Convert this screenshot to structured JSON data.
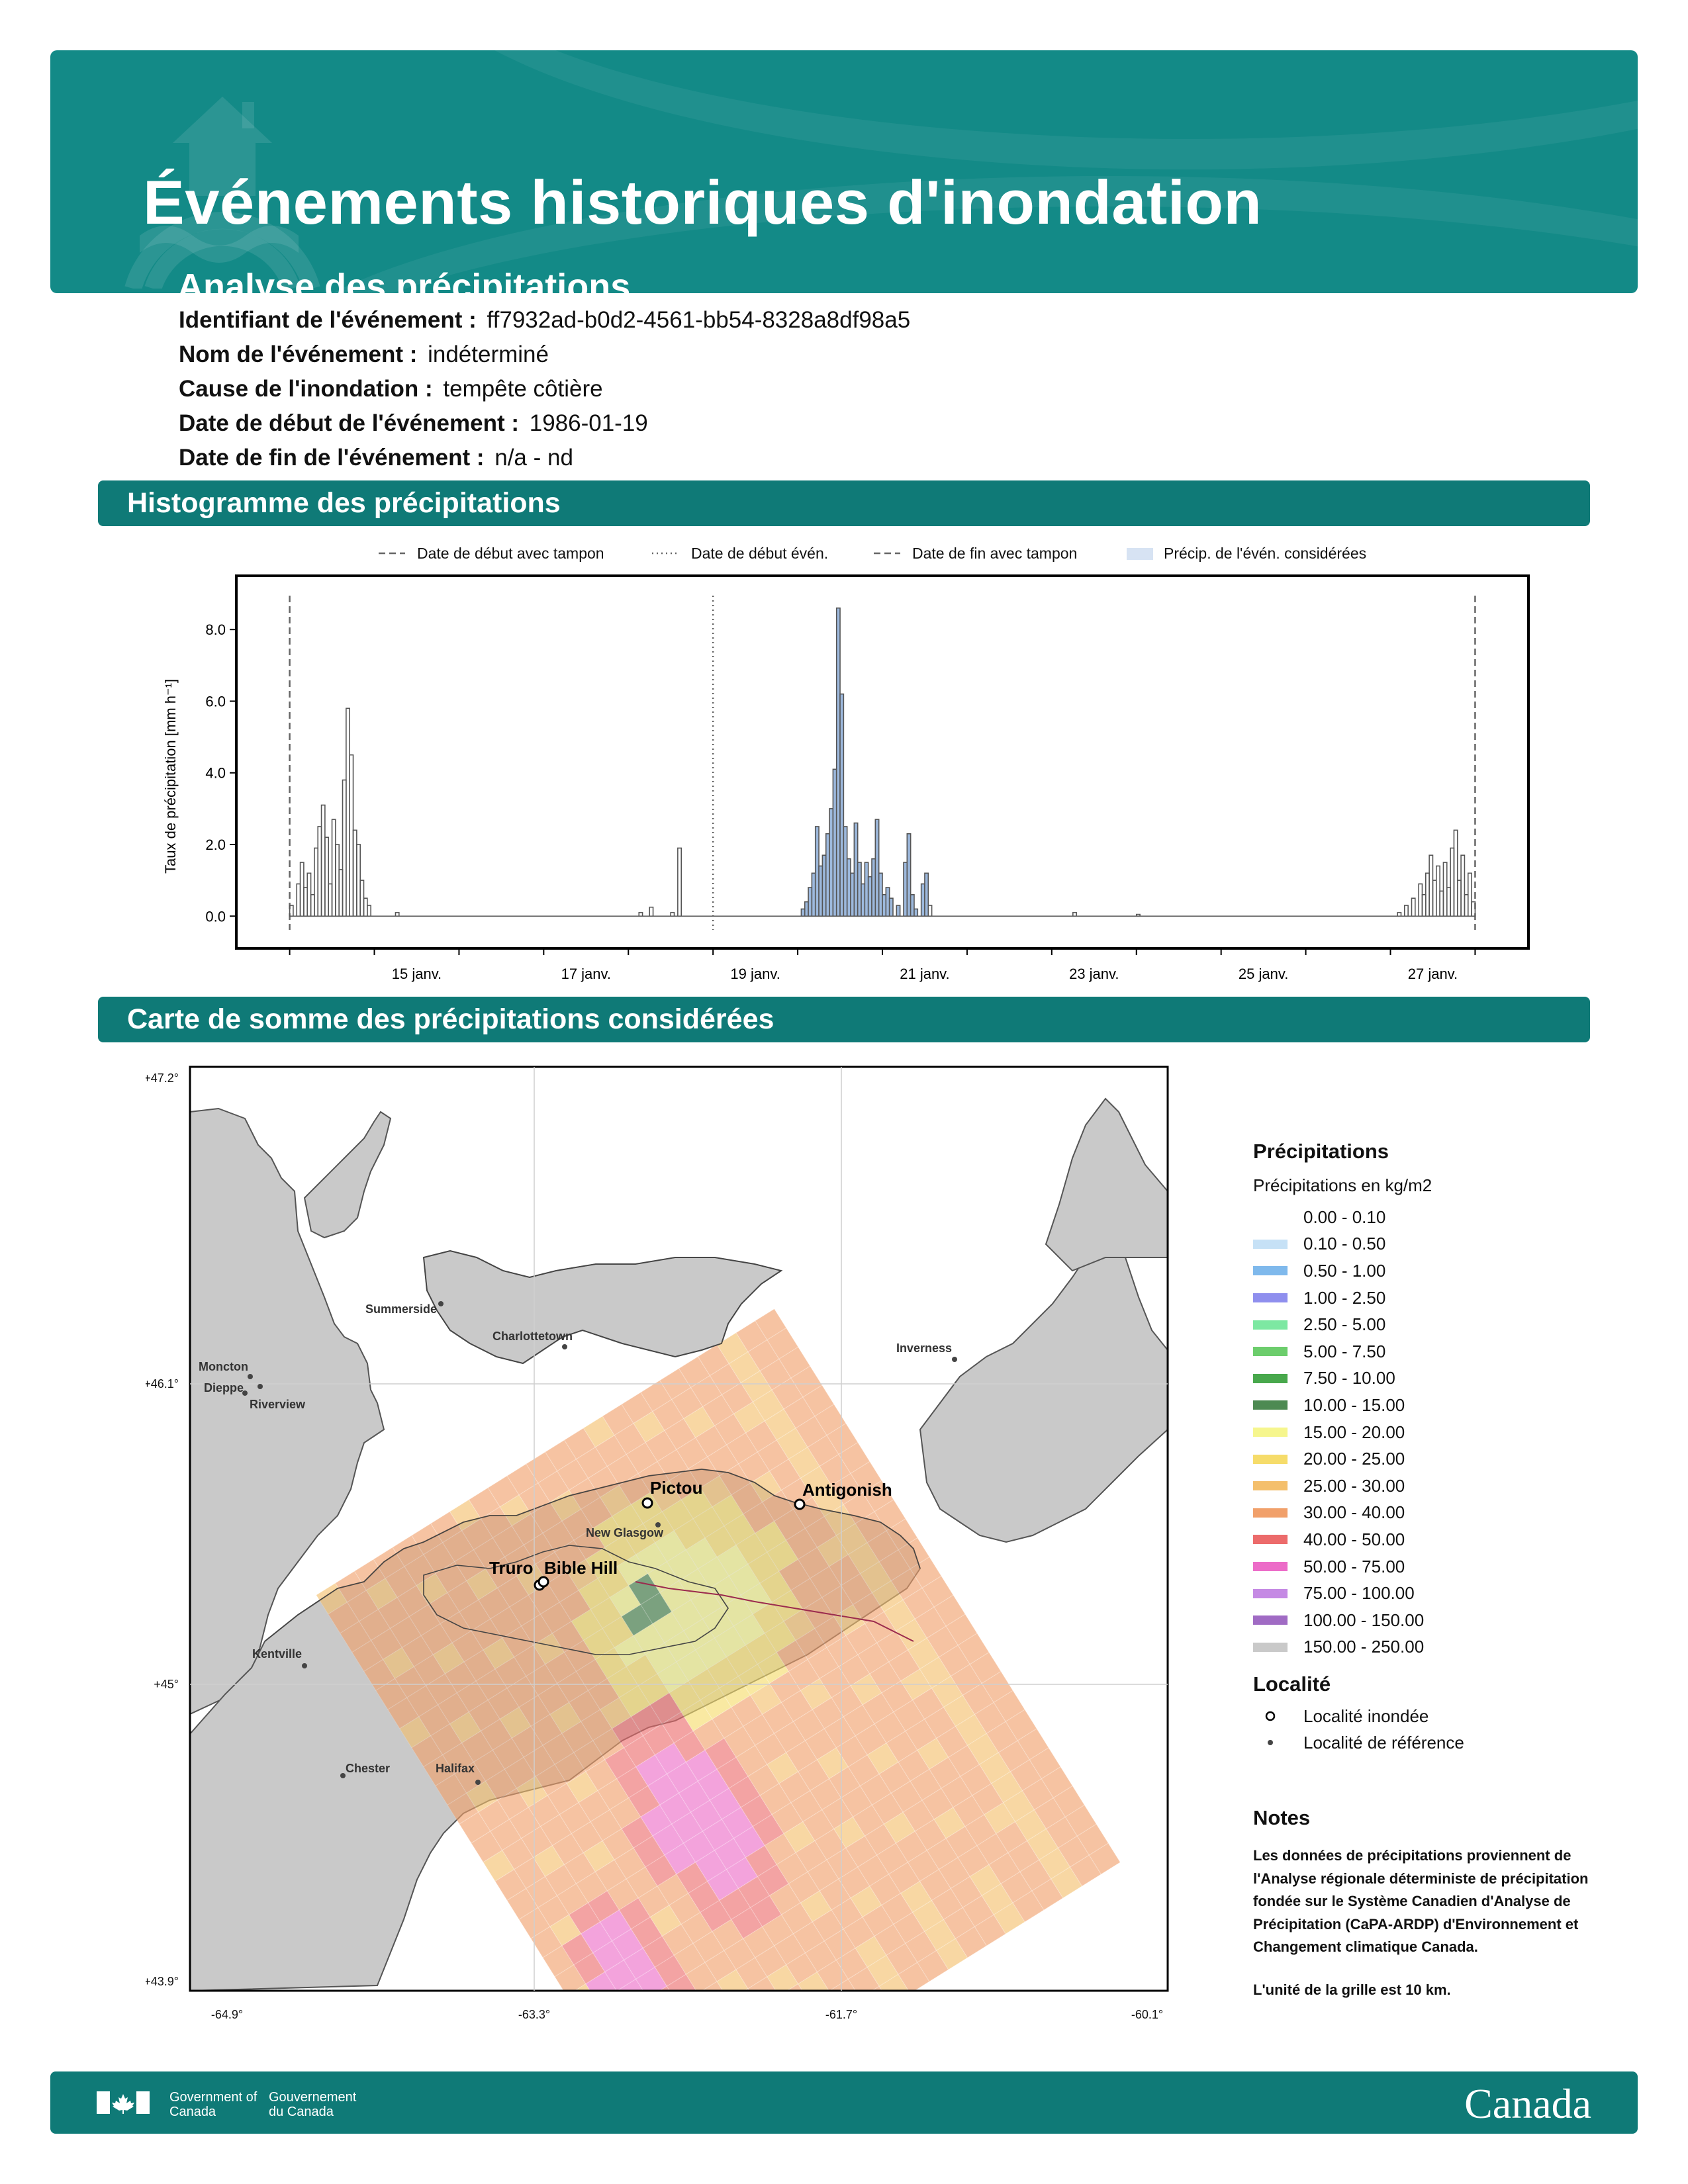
{
  "header": {
    "title": "Événements historiques d'inondation",
    "subtitle": "Analyse des précipitations"
  },
  "event": {
    "id_label": "Identifiant de l'événement :",
    "id_value": "ff7932ad-b0d2-4561-bb54-8328a8df98a5",
    "name_label": "Nom de l'événement :",
    "name_value": "indéterminé",
    "cause_label": "Cause de l'inondation :",
    "cause_value": "tempête côtière",
    "start_label": "Date de début de l'événement :",
    "start_value": "1986-01-19",
    "end_label": "Date de fin de l'événement :",
    "end_value": "n/a - nd"
  },
  "sections": {
    "histogram": "Histogramme des précipitations",
    "map": "Carte de somme des précipitations considérées"
  },
  "chart_data": {
    "type": "bar",
    "ylabel": "Taux de précipitation [mm h⁻¹]",
    "ylim": [
      -0.9,
      9.5
    ],
    "yticks": [
      "0.0",
      "2.0",
      "4.0",
      "6.0",
      "8.0"
    ],
    "x_range_days": [
      "1986-01-14",
      "1986-01-28"
    ],
    "xticks": [
      "15 janv.",
      "17 janv.",
      "19 janv.",
      "21 janv.",
      "23 janv.",
      "25 janv.",
      "27 janv."
    ],
    "legend": {
      "buffered_start": "Date de début avec tampon",
      "event_start": "Date de début évén.",
      "buffered_end": "Date de fin avec tampon",
      "considered": "Précip. de l'évén. considérées"
    },
    "reference_lines": {
      "buffered_start": "1986-01-14T00:00",
      "event_start": "1986-01-19T00:00",
      "buffered_end": "1986-01-28T00:00"
    },
    "considered_window": [
      "1986-01-20T00:00",
      "1986-01-21T12:00"
    ],
    "series_points": [
      [
        "1986-01-14T00:00",
        0.3
      ],
      [
        "1986-01-14T02:00",
        0.9
      ],
      [
        "1986-01-14T03:00",
        1.5
      ],
      [
        "1986-01-14T04:00",
        0.8
      ],
      [
        "1986-01-14T05:00",
        1.2
      ],
      [
        "1986-01-14T06:00",
        0.6
      ],
      [
        "1986-01-14T07:00",
        1.9
      ],
      [
        "1986-01-14T08:00",
        2.5
      ],
      [
        "1986-01-14T09:00",
        3.1
      ],
      [
        "1986-01-14T10:00",
        2.2
      ],
      [
        "1986-01-14T11:00",
        0.9
      ],
      [
        "1986-01-14T12:00",
        2.7
      ],
      [
        "1986-01-14T13:00",
        2.0
      ],
      [
        "1986-01-14T14:00",
        1.3
      ],
      [
        "1986-01-14T15:00",
        3.8
      ],
      [
        "1986-01-14T16:00",
        5.8
      ],
      [
        "1986-01-14T17:00",
        4.5
      ],
      [
        "1986-01-14T18:00",
        2.4
      ],
      [
        "1986-01-14T19:00",
        2.0
      ],
      [
        "1986-01-14T20:00",
        1.0
      ],
      [
        "1986-01-14T21:00",
        0.5
      ],
      [
        "1986-01-14T22:00",
        0.3
      ],
      [
        "1986-01-15T06:00",
        0.1
      ],
      [
        "1986-01-18T03:00",
        0.1
      ],
      [
        "1986-01-18T06:00",
        0.25
      ],
      [
        "1986-01-18T12:00",
        0.1
      ],
      [
        "1986-01-18T14:00",
        1.9
      ],
      [
        "1986-01-20T01:00",
        0.2
      ],
      [
        "1986-01-20T02:00",
        0.4
      ],
      [
        "1986-01-20T03:00",
        0.8
      ],
      [
        "1986-01-20T04:00",
        1.2
      ],
      [
        "1986-01-20T05:00",
        2.5
      ],
      [
        "1986-01-20T06:00",
        1.4
      ],
      [
        "1986-01-20T07:00",
        1.7
      ],
      [
        "1986-01-20T08:00",
        2.3
      ],
      [
        "1986-01-20T09:00",
        3.0
      ],
      [
        "1986-01-20T10:00",
        4.1
      ],
      [
        "1986-01-20T11:00",
        8.6
      ],
      [
        "1986-01-20T12:00",
        6.2
      ],
      [
        "1986-01-20T13:00",
        2.5
      ],
      [
        "1986-01-20T14:00",
        1.6
      ],
      [
        "1986-01-20T15:00",
        1.2
      ],
      [
        "1986-01-20T16:00",
        2.6
      ],
      [
        "1986-01-20T17:00",
        1.5
      ],
      [
        "1986-01-20T18:00",
        0.9
      ],
      [
        "1986-01-20T19:00",
        1.5
      ],
      [
        "1986-01-20T20:00",
        1.1
      ],
      [
        "1986-01-20T21:00",
        1.6
      ],
      [
        "1986-01-20T22:00",
        2.7
      ],
      [
        "1986-01-20T23:00",
        1.2
      ],
      [
        "1986-01-21T00:00",
        0.6
      ],
      [
        "1986-01-21T01:00",
        0.8
      ],
      [
        "1986-01-21T02:00",
        0.5
      ],
      [
        "1986-01-21T04:00",
        0.3
      ],
      [
        "1986-01-21T06:00",
        1.5
      ],
      [
        "1986-01-21T07:00",
        2.3
      ],
      [
        "1986-01-21T08:00",
        0.6
      ],
      [
        "1986-01-21T09:00",
        0.2
      ],
      [
        "1986-01-21T11:00",
        0.9
      ],
      [
        "1986-01-21T12:00",
        1.2
      ],
      [
        "1986-01-21T13:00",
        0.3
      ],
      [
        "1986-01-23T06:00",
        0.1
      ],
      [
        "1986-01-24T00:00",
        0.05
      ],
      [
        "1986-01-27T02:00",
        0.1
      ],
      [
        "1986-01-27T04:00",
        0.3
      ],
      [
        "1986-01-27T06:00",
        0.5
      ],
      [
        "1986-01-27T08:00",
        0.9
      ],
      [
        "1986-01-27T09:00",
        0.6
      ],
      [
        "1986-01-27T10:00",
        1.2
      ],
      [
        "1986-01-27T11:00",
        1.7
      ],
      [
        "1986-01-27T12:00",
        1.0
      ],
      [
        "1986-01-27T13:00",
        1.4
      ],
      [
        "1986-01-27T14:00",
        0.7
      ],
      [
        "1986-01-27T15:00",
        1.5
      ],
      [
        "1986-01-27T16:00",
        0.8
      ],
      [
        "1986-01-27T17:00",
        1.9
      ],
      [
        "1986-01-27T18:00",
        2.4
      ],
      [
        "1986-01-27T19:00",
        1.0
      ],
      [
        "1986-01-27T20:00",
        1.7
      ],
      [
        "1986-01-27T21:00",
        0.6
      ],
      [
        "1986-01-27T22:00",
        1.2
      ],
      [
        "1986-01-27T23:00",
        0.4
      ]
    ]
  },
  "map": {
    "lat_labels": [
      "+47.2°",
      "+46.1°",
      "+45°",
      "+43.9°"
    ],
    "lon_labels": [
      "-64.9°",
      "-63.3°",
      "-61.7°",
      "-60.1°"
    ],
    "places_reference": [
      "Summerside",
      "Charlottetown",
      "Moncton",
      "Dieppe",
      "Riverview",
      "Inverness",
      "New Glasgow",
      "Kentville",
      "Chester",
      "Halifax"
    ],
    "places_flooded": [
      "Pictou",
      "Antigonish",
      "Truro",
      "Bible Hill"
    ]
  },
  "legend": {
    "title": "Précipitations",
    "subtitle": "Précipitations en kg/m2",
    "classes": [
      {
        "label": "0.00 - 0.10",
        "color": "#ffffff"
      },
      {
        "label": "0.10 - 0.50",
        "color": "#c6e1f6"
      },
      {
        "label": "0.50 - 1.00",
        "color": "#7fb9ec"
      },
      {
        "label": "1.00 - 2.50",
        "color": "#8f8fee"
      },
      {
        "label": "2.50 - 5.00",
        "color": "#7de8a2"
      },
      {
        "label": "5.00 - 7.50",
        "color": "#6ccd6c"
      },
      {
        "label": "7.50 - 10.00",
        "color": "#48a84c"
      },
      {
        "label": "10.00 - 15.00",
        "color": "#4d8a52"
      },
      {
        "label": "15.00 - 20.00",
        "color": "#f6f68d"
      },
      {
        "label": "20.00 - 25.00",
        "color": "#f6dc6a"
      },
      {
        "label": "25.00 - 30.00",
        "color": "#f4bf6c"
      },
      {
        "label": "30.00 - 40.00",
        "color": "#f1a06a"
      },
      {
        "label": "40.00 - 50.00",
        "color": "#ec6b6b"
      },
      {
        "label": "50.00 - 75.00",
        "color": "#ec6cc8"
      },
      {
        "label": "75.00 - 100.00",
        "color": "#c58ae4"
      },
      {
        "label": "100.00 - 150.00",
        "color": "#a06bc4"
      },
      {
        "label": "150.00 - 250.00",
        "color": "#c9c9c9"
      }
    ],
    "locality_title": "Localité",
    "flooded_label": "Localité inondée",
    "reference_label": "Localité de référence",
    "notes_title": "Notes",
    "notes_text": "Les données de précipitations proviennent de l'Analyse régionale déterministe de précipitation fondée sur le Système Canadien d'Analyse de Précipitation (CaPA-ARDP) d'Environnement et Changement climatique Canada.",
    "notes_unit": "L'unité de la grille est 10 km."
  },
  "footer": {
    "gov_en": "Government of Canada",
    "gov_fr": "Gouvernement du Canada",
    "wordmark": "Canada"
  },
  "colors": {
    "banner": "#138a87",
    "section_bar": "#0f7a77",
    "considered_fill": "#9db9dd"
  }
}
